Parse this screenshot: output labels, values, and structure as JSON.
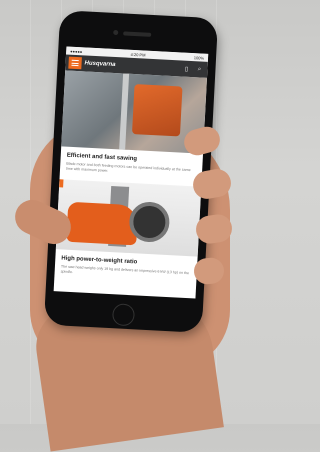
{
  "statusbar": {
    "carrier": "●●●●●",
    "time": "4:20 PM",
    "battery": "100%"
  },
  "appbar": {
    "logo": "Husqvarna",
    "icons": [
      "menu-icon",
      "document-icon",
      "search-icon"
    ]
  },
  "articles": [
    {
      "title": "Efficient and fast sawing",
      "text": "Blade motor and both feeding motors can be operated individually at the same time with maximum power."
    },
    {
      "title": "High power-to-weight ratio",
      "text": "The saw head weighs only 19 kg and delivers an impressive 6 kW (13 hp) on the spindle."
    }
  ],
  "colors": {
    "accent": "#ec6a1f",
    "appbar": "#333436"
  }
}
